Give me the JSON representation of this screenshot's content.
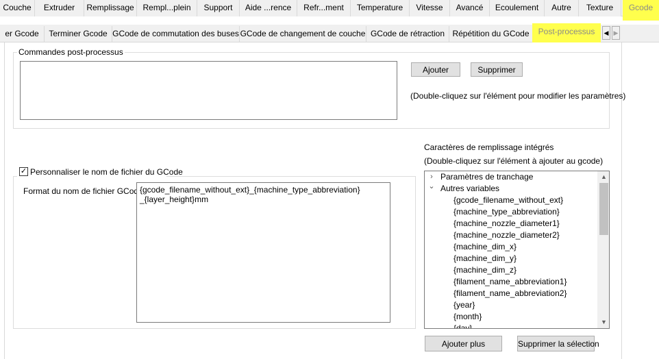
{
  "tabs_row1": [
    {
      "label": "Couche"
    },
    {
      "label": "Extruder"
    },
    {
      "label": "Remplissage"
    },
    {
      "label": "Rempl...plein"
    },
    {
      "label": "Support"
    },
    {
      "label": "Aide ...rence"
    },
    {
      "label": "Refr...ment"
    },
    {
      "label": "Temperature"
    },
    {
      "label": "Vitesse"
    },
    {
      "label": "Avancé"
    },
    {
      "label": "Ecoulement"
    },
    {
      "label": "Autre"
    },
    {
      "label": "Texture"
    },
    {
      "label": "Gcode"
    }
  ],
  "tabs_row2": [
    {
      "label": "er Gcode"
    },
    {
      "label": "Terminer Gcode"
    },
    {
      "label": "GCode de commutation des buses"
    },
    {
      "label": "GCode de changement de couche"
    },
    {
      "label": "GCode de rétraction"
    },
    {
      "label": "Répétition du GCode"
    },
    {
      "label": "Post-processus"
    }
  ],
  "tab_scroll": {
    "left": "◀",
    "right": "▶"
  },
  "post": {
    "group_title": "Commandes post-processus",
    "add_button": "Ajouter",
    "delete_button": "Supprimer",
    "hint": "(Double-cliquez sur l'élément pour modifier les paramètres)"
  },
  "filename": {
    "checked": true,
    "checkbox_label": "Personnaliser le nom de fichier du GCode",
    "format_label": "Format du nom de fichier GCode",
    "format_line1": "{gcode_filename_without_ext}_{machine_type_abbreviation}",
    "format_line2": "_{layer_height}mm"
  },
  "placeholders": {
    "title": "Caractères de remplissage intégrés",
    "hint": "(Double-cliquez sur l'élément à ajouter au gcode)",
    "tree": [
      {
        "label": "Paramètres de tranchage",
        "indent": 0,
        "expander": "›"
      },
      {
        "label": "Autres variables",
        "indent": 0,
        "expander": "⌄"
      },
      {
        "label": "{gcode_filename_without_ext}",
        "indent": 1
      },
      {
        "label": "{machine_type_abbreviation}",
        "indent": 1
      },
      {
        "label": "{machine_nozzle_diameter1}",
        "indent": 1
      },
      {
        "label": "{machine_nozzle_diameter2}",
        "indent": 1
      },
      {
        "label": "{machine_dim_x}",
        "indent": 1
      },
      {
        "label": "{machine_dim_y}",
        "indent": 1
      },
      {
        "label": "{machine_dim_z}",
        "indent": 1
      },
      {
        "label": "{filament_name_abbreviation1}",
        "indent": 1
      },
      {
        "label": "{filament_name_abbreviation2}",
        "indent": 1
      },
      {
        "label": "{year}",
        "indent": 1
      },
      {
        "label": "{month}",
        "indent": 1
      },
      {
        "label": "{day}",
        "indent": 1
      }
    ],
    "add_more_button": "Ajouter plus",
    "delete_selection_button": "Supprimer la sélection"
  },
  "colors": {
    "highlight": "#ffff4d"
  }
}
